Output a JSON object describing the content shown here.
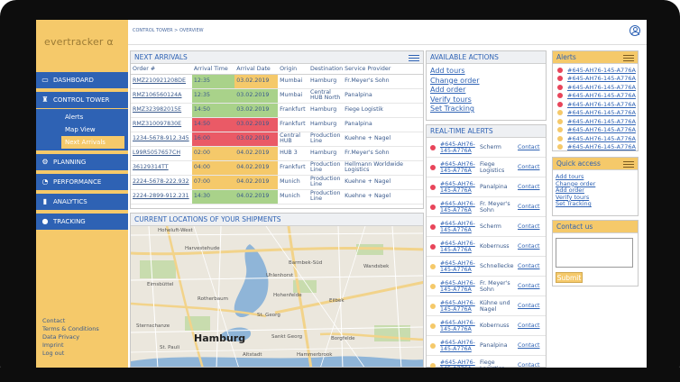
{
  "app": {
    "logo": "evertracker α"
  },
  "header": {
    "breadcrumb": "CONTROL TOWER  >  OVERVIEW"
  },
  "nav": {
    "dashboard": "DASHBOARD",
    "control_tower": "CONTROL TOWER",
    "sub": [
      "Alerts",
      "Map View",
      "Next Arrivals"
    ],
    "planning": "PLANNING",
    "performance": "PERFORMANCE",
    "analytics": "ANALYTICS",
    "tracking": "TRACKING"
  },
  "footer": [
    "Contact",
    "Terms & Conditions",
    "Data Privacy",
    "Imprint",
    "Log out"
  ],
  "arrivals": {
    "title": "NEXT ARRIVALS",
    "columns": [
      "Order #",
      "Arrival Time",
      "Arrival Date",
      "Origin",
      "Destination",
      "Service Provider"
    ],
    "rows": [
      {
        "order": "RMZ210921208DE",
        "time": "12:35",
        "date": "03.02.2019",
        "origin": "Mumbai",
        "dest": "Hamburg",
        "provider": "Fr.Meyer's Sohn",
        "tc": "green",
        "dc": "yellow"
      },
      {
        "order": "RMZ106560124A",
        "time": "12:35",
        "date": "03.02.2019",
        "origin": "Mumbai",
        "dest": "Central HUB North",
        "provider": "Panalpina",
        "tc": "green",
        "dc": "green"
      },
      {
        "order": "RMZ323982015E",
        "time": "14:50",
        "date": "03.02.2019",
        "origin": "Frankfurt",
        "dest": "Hamburg",
        "provider": "Fiege Logistik",
        "tc": "green",
        "dc": "green"
      },
      {
        "order": "RMZ310097830E",
        "time": "14:50",
        "date": "03.02.2019",
        "origin": "Frankfurt",
        "dest": "Hamburg",
        "provider": "Panalpina",
        "tc": "red",
        "dc": "red"
      },
      {
        "order": "1234-5678-912.345",
        "time": "16:00",
        "date": "03.02.2019",
        "origin": "Central HUB",
        "dest": "Production Line",
        "provider": "Kuehne + Nagel",
        "tc": "red",
        "dc": "red"
      },
      {
        "order": "L99R5057657CH",
        "time": "02:00",
        "date": "04.02.2019",
        "origin": "HUB 3",
        "dest": "Hamburg",
        "provider": "Fr.Meyer's Sohn",
        "tc": "yellow",
        "dc": "yellow"
      },
      {
        "order": "36129314TT",
        "time": "04:00",
        "date": "04.02.2019",
        "origin": "Frankfurt",
        "dest": "Production Line",
        "provider": "Hellmann Worldwide Logistics",
        "tc": "yellow",
        "dc": "yellow"
      },
      {
        "order": "2224-5678-222.932",
        "time": "07:00",
        "date": "04.02.2019",
        "origin": "Munich",
        "dest": "Production Line",
        "provider": "Kuehne + Nagel",
        "tc": "yellow",
        "dc": "yellow"
      },
      {
        "order": "2224-2899-912.231",
        "time": "14:30",
        "date": "04.02.2019",
        "origin": "Munich",
        "dest": "Production Line",
        "provider": "Kuehne + Nagel",
        "tc": "green",
        "dc": "green"
      }
    ]
  },
  "actions": {
    "title": "AVAILABLE ACTIONS",
    "items": [
      "Add tours",
      "Change order",
      "Add order",
      "Verify tours",
      "Set Tracking"
    ]
  },
  "realtime": {
    "title": "REAL-TIME ALERTS",
    "rows": [
      {
        "id": "#645-AH76-145-A776A",
        "prov": "Scherm",
        "contact": "Contact",
        "c": "red"
      },
      {
        "id": "#645-AH76-145-A776A",
        "prov": "Fiege Logistics",
        "contact": "Contact",
        "c": "red"
      },
      {
        "id": "#645-AH76-145-A776A",
        "prov": "Panalpina",
        "contact": "Contact",
        "c": "red"
      },
      {
        "id": "#645-AH76-145-A776A",
        "prov": "Fr. Meyer's Sohn",
        "contact": "Contact",
        "c": "red"
      },
      {
        "id": "#645-AH76-145-A776A",
        "prov": "Scherm",
        "contact": "Contact",
        "c": "red"
      },
      {
        "id": "#645-AH76-145-A776A",
        "prov": "Kobernuss",
        "contact": "Contact",
        "c": "red"
      },
      {
        "id": "#645-AH76-145-A776A",
        "prov": "Schnellecke",
        "contact": "Contact",
        "c": "yellow"
      },
      {
        "id": "#645-AH76-145-A776A",
        "prov": "Fr. Meyer's Sohn",
        "contact": "Contact",
        "c": "yellow"
      },
      {
        "id": "#645-AH76-145-A776A",
        "prov": "Kühne und Nagel",
        "contact": "Contact",
        "c": "yellow"
      },
      {
        "id": "#645-AH76-145-A776A",
        "prov": "Kobernuss",
        "contact": "Contact",
        "c": "yellow"
      },
      {
        "id": "#645-AH76-145-A776A",
        "prov": "Panalpina",
        "contact": "Contact",
        "c": "yellow"
      },
      {
        "id": "#645-AH76-145-A776A",
        "prov": "Fiege Logistics",
        "contact": "Contact",
        "c": "yellow"
      }
    ]
  },
  "alerts": {
    "title": "Alerts",
    "items": [
      {
        "t": "#645-AH76-145-A776A",
        "c": "red"
      },
      {
        "t": "#645-AH76-145-A776A",
        "c": "red"
      },
      {
        "t": "#645-AH76-145-A776A",
        "c": "red"
      },
      {
        "t": "#645-AH76-145-A776A",
        "c": "red"
      },
      {
        "t": "#645-AH76-145-A776A",
        "c": "red"
      },
      {
        "t": "#645-AH76-145-A776A",
        "c": "yellow"
      },
      {
        "t": "#645-AH76-145-A776A",
        "c": "yellow"
      },
      {
        "t": "#645-AH76-145-A776A",
        "c": "yellow"
      },
      {
        "t": "#645-AH76-145-A776A",
        "c": "yellow"
      },
      {
        "t": "#645-AH76-145-A776A",
        "c": "yellow"
      }
    ]
  },
  "quick": {
    "title": "Quick access",
    "items": [
      "Add tours",
      "Change order",
      "Add order",
      "Verify tours",
      "Set Tracking"
    ]
  },
  "contact": {
    "title": "Contact us",
    "submit": "Submit"
  },
  "map": {
    "title": "CURRENT LOCATIONS OF YOUR SHIPMENTS",
    "labels": [
      "Hamburg",
      "Eimsbüttel",
      "Barmbek-Süd",
      "Uhlenhorst",
      "Hohenfelde",
      "Eilbek",
      "St. Georg",
      "Rotherbaum",
      "Sternschanze",
      "Altstadt",
      "Borgfelde",
      "Harvestehude",
      "Wandsbek",
      "St. Pauli",
      "Hoheluft-West",
      "Sankt Georg",
      "Hammerbrook"
    ]
  },
  "colors": {
    "brand_yellow": "#f5c96a",
    "brand_blue": "#2e62b4",
    "status_green": "#a9d28a",
    "status_red": "#ea5a66"
  }
}
